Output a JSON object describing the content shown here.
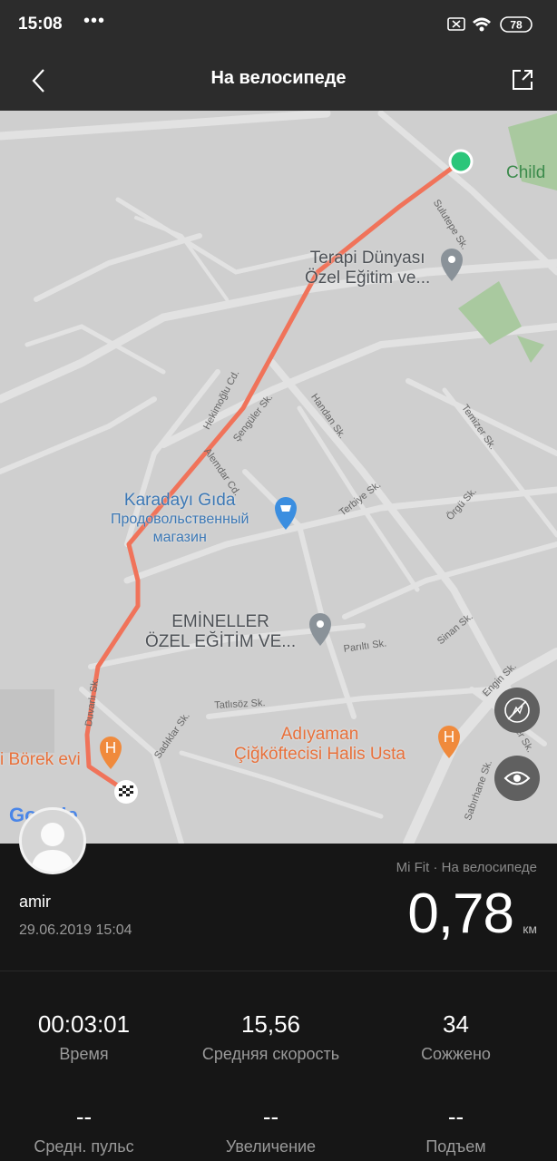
{
  "status_bar": {
    "time": "15:08",
    "dots": "•••",
    "battery": "78"
  },
  "app_bar": {
    "title": "На велосипеде"
  },
  "map": {
    "pois": [
      {
        "line1": "Terapi Dünyası",
        "line2": "Özel Eğitim ve..."
      },
      {
        "line1": "Karadayı Gıda",
        "line2": "Продовольственный",
        "line3": "магазин"
      },
      {
        "line1": "EMİNELLER",
        "line2": "ÖZEL EĞİTİM VE..."
      },
      {
        "line1": "Adıyaman",
        "line2": "Çiğköftecisi Halis Usta"
      },
      {
        "line1": "i Börek evi"
      },
      {
        "line1": "Child"
      }
    ],
    "streets": [
      "Sulutepe Sk.",
      "Hekimoğlu Cd.",
      "Şengüler Sk.",
      "Handan Sk.",
      "Temizer Sk.",
      "Alemdar Cd.",
      "Terbiye Sk.",
      "Örgü Sk.",
      "Sinan Sk.",
      "Parıltı Sk.",
      "Duvarlı Sk.",
      "Tatlısöz Sk.",
      "Sadıklar Sk.",
      "Engin Sk.",
      "Ünver Sk.",
      "Sabırhane Sk."
    ],
    "logo": "Google",
    "route_color": "#f0735a",
    "start_color": "#2bc67a"
  },
  "workout": {
    "username": "amir",
    "date": "29.06.2019 15:04",
    "source": "Mi Fit · На велосипеде",
    "distance": "0,78",
    "distance_unit": "км"
  },
  "stats": [
    {
      "value": "00:03:01",
      "label": "Время"
    },
    {
      "value": "15,56",
      "label": "Средняя скорость"
    },
    {
      "value": "34",
      "label": "Сожжено"
    },
    {
      "value": "--",
      "label": "Средн. пульс"
    },
    {
      "value": "--",
      "label": "Увеличение"
    },
    {
      "value": "--",
      "label": "Подъем"
    }
  ]
}
